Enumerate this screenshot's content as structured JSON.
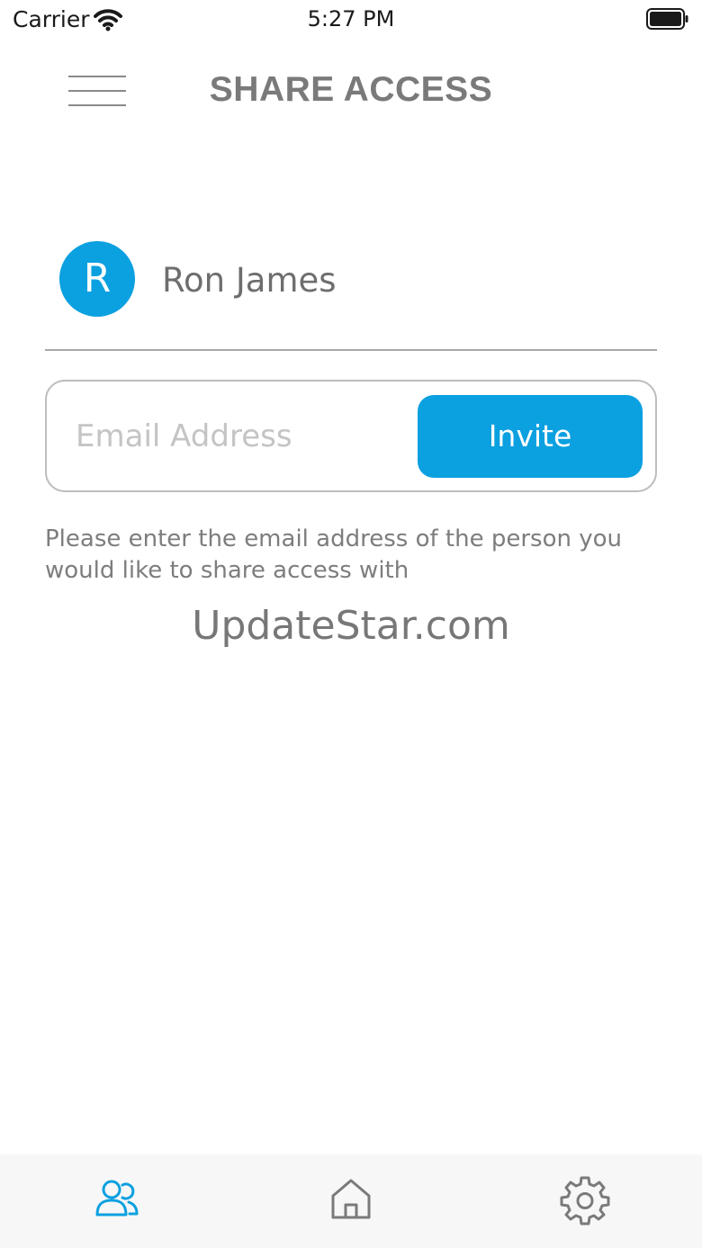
{
  "status_bar": {
    "carrier": "Carrier",
    "time": "5:27 PM"
  },
  "header": {
    "title": "SHARE ACCESS"
  },
  "user": {
    "initial": "R",
    "name": "Ron James",
    "avatar_color": "#0BA0E0"
  },
  "invite": {
    "email_placeholder": "Email Address",
    "email_value": "",
    "button_label": "Invite"
  },
  "help_text": "Please enter the email address of the person you would like to share access with",
  "watermark": "UpdateStar.com",
  "tab_bar": {
    "tabs": [
      {
        "icon": "people-icon",
        "active": true
      },
      {
        "icon": "home-icon",
        "active": false
      },
      {
        "icon": "gear-icon",
        "active": false
      }
    ],
    "active_color": "#0BA0E0",
    "inactive_color": "#7A7A7A"
  }
}
